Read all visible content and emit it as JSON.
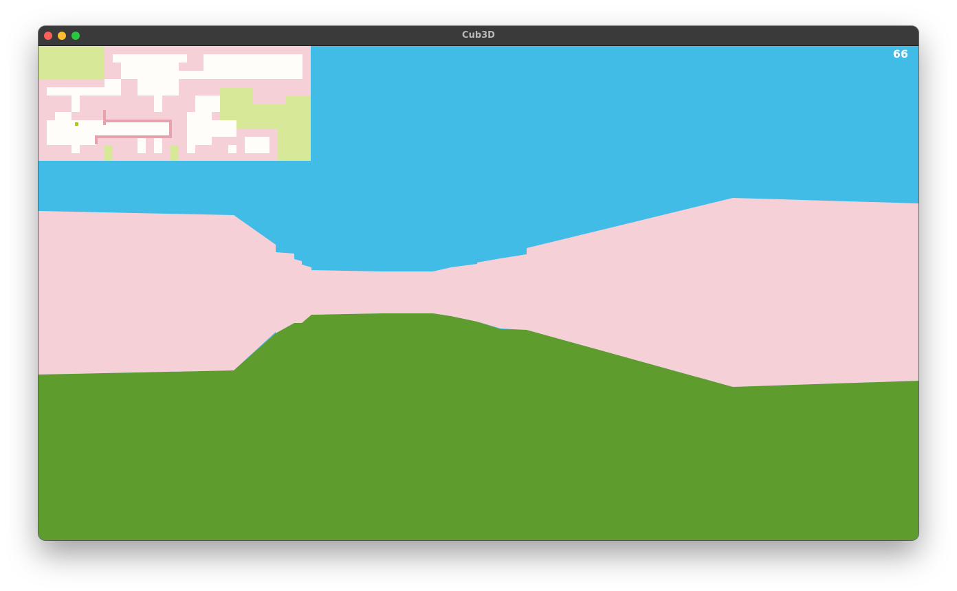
{
  "window": {
    "title": "Cub3D"
  },
  "hud": {
    "fps": "66"
  },
  "colors": {
    "sky": "#40bce6",
    "wall": "#f6d0d7",
    "floor": "#5e9c2d",
    "map_wall": "#f6d0d7",
    "map_floor": "#fffdfa",
    "map_outside": "#d7e898",
    "map_ray": "#e8a2ae",
    "map_player": "#b6c416",
    "titlebar": "#3a3a3a",
    "traffic_close": "#fe5f57",
    "traffic_minimize": "#febc2e",
    "traffic_zoom": "#28c840"
  }
}
